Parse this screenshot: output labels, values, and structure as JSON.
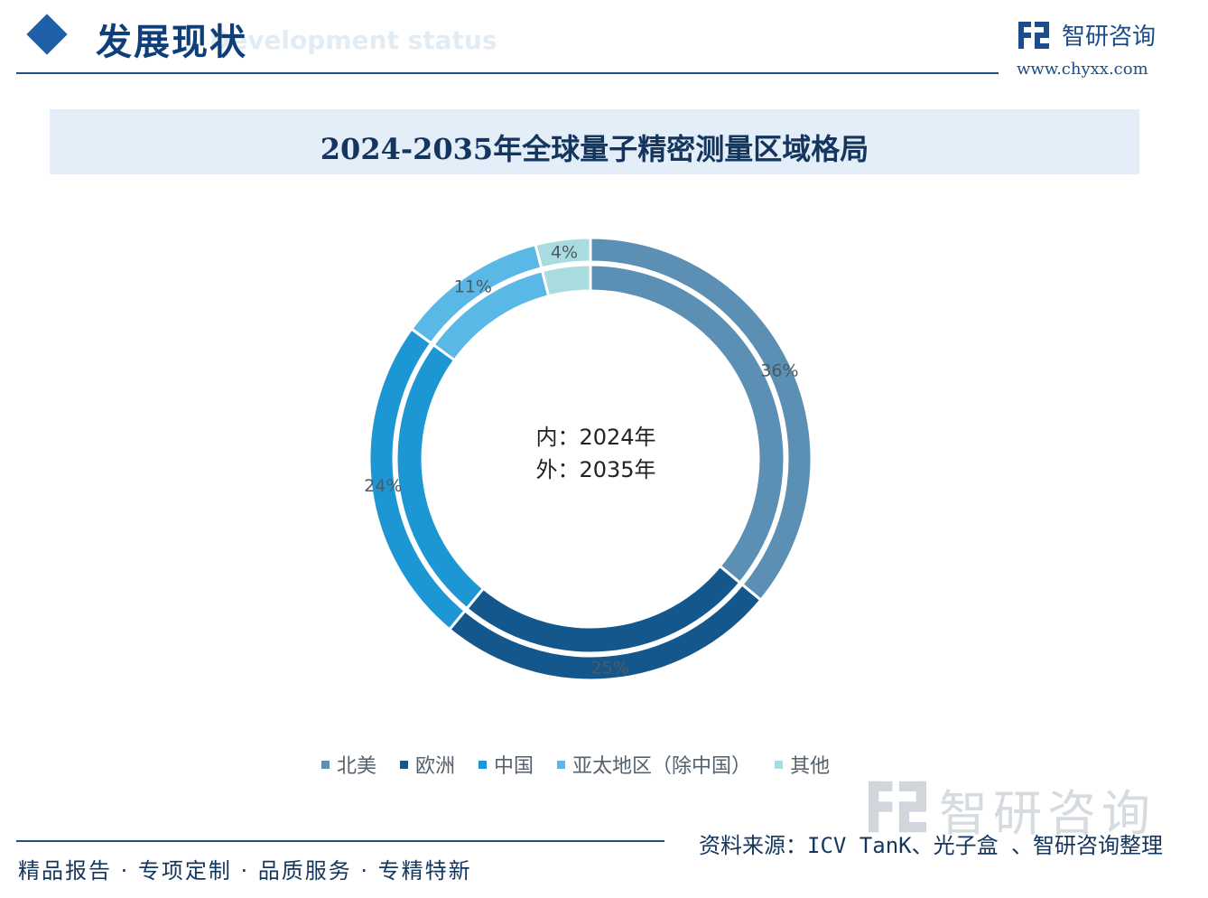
{
  "header": {
    "title": "发展现状",
    "subtitle": "Development status",
    "logo_name": "智研咨询",
    "logo_url": "www.chyxx.com"
  },
  "chart_title": "2024-2035年全球量子精密测量区域格局",
  "center_label": {
    "inner": "内：2024年",
    "outer": "外：2035年"
  },
  "chart_data": {
    "type": "pie",
    "title": "2024-2035年全球量子精密测量区域格局",
    "categories": [
      "北美",
      "欧洲",
      "中国",
      "亚太地区（除中国）",
      "其他"
    ],
    "colors": [
      "#5b8fb3",
      "#14578c",
      "#1c97d4",
      "#5ab8e6",
      "#a9dcdf"
    ],
    "series": [
      {
        "name": "2024年",
        "values": [
          36,
          25,
          24,
          11,
          4
        ]
      },
      {
        "name": "2035年",
        "values": [
          36,
          25,
          24,
          11,
          4
        ]
      }
    ],
    "data_labels": [
      "36%",
      "25%",
      "24%",
      "11%",
      "4%"
    ],
    "legend_position": "bottom"
  },
  "footer": {
    "source": "资料来源：ICV TanK、光子盒 、智研咨询整理",
    "slogan": "精品报告 · 专项定制 · 品质服务 · 专精特新",
    "watermark_name": "智研咨询"
  }
}
